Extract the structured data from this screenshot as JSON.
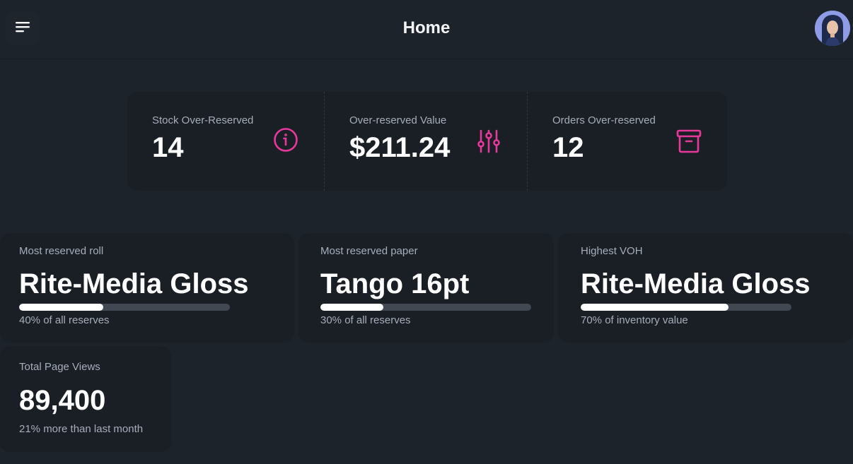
{
  "header": {
    "title": "Home",
    "menu_icon": "menu-icon",
    "avatar": "user-avatar"
  },
  "stats": [
    {
      "title": "Stock Over-Reserved",
      "value": "14",
      "icon": "info-icon",
      "icon_color": "#e6399b"
    },
    {
      "title": "Over-reserved Value",
      "value": "$211.24",
      "icon": "sliders-icon",
      "icon_color": "#e6399b"
    },
    {
      "title": "Orders Over-reserved",
      "value": "12",
      "icon": "archive-icon",
      "icon_color": "#e6399b"
    }
  ],
  "cards": [
    {
      "title": "Most reserved roll",
      "value": "Rite-Media Gloss",
      "progress": 0.4,
      "desc": "40% of all reserves"
    },
    {
      "title": "Most reserved paper",
      "value": "Tango 16pt",
      "progress": 0.3,
      "desc": "30% of all reserves"
    },
    {
      "title": "Highest VOH",
      "value": "Rite-Media Gloss",
      "progress": 0.7,
      "desc": "70% of inventory value"
    }
  ],
  "page_views": {
    "title": "Total Page Views",
    "value": "89,400",
    "desc": "21% more than last month"
  },
  "colors": {
    "background": "#1d232a",
    "accent": "#e6399b",
    "progress_track": "#414852",
    "progress_fill": "#ffffff"
  }
}
